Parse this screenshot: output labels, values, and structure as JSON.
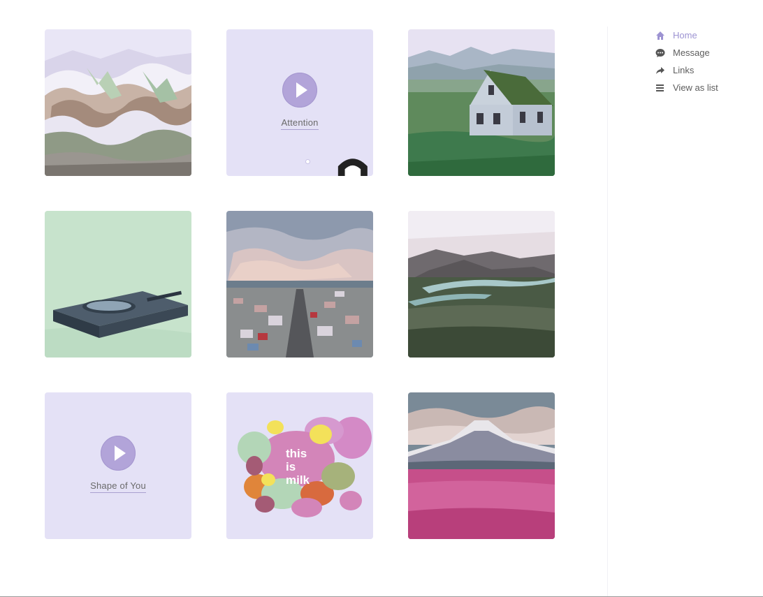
{
  "grid": {
    "tiles": [
      {
        "kind": "photo",
        "subject": "snowy striped mountains"
      },
      {
        "kind": "music",
        "title": "Attention"
      },
      {
        "kind": "photo",
        "subject": "white turf-roof house on grassland"
      },
      {
        "kind": "photo",
        "subject": "dark stone tray on mint background"
      },
      {
        "kind": "photo",
        "subject": "aerial city street view"
      },
      {
        "kind": "photo",
        "subject": "river valley with hills"
      },
      {
        "kind": "music",
        "title": "Shape of You"
      },
      {
        "kind": "artwork",
        "text_lines": [
          "this",
          "is",
          "milk"
        ]
      },
      {
        "kind": "photo",
        "subject": "snowcapped volcano over pink flower field"
      }
    ]
  },
  "nav": {
    "items": [
      {
        "label": "Home",
        "icon": "home-icon",
        "active": true
      },
      {
        "label": "Message",
        "icon": "message-icon",
        "active": false
      },
      {
        "label": "Links",
        "icon": "share-arrow-icon",
        "active": false
      },
      {
        "label": "View as list",
        "icon": "list-icon",
        "active": false
      }
    ]
  },
  "colors": {
    "accent": "#9d93d2",
    "tile_lavender": "#e4e1f6",
    "play_button": "#b2a4d9"
  }
}
